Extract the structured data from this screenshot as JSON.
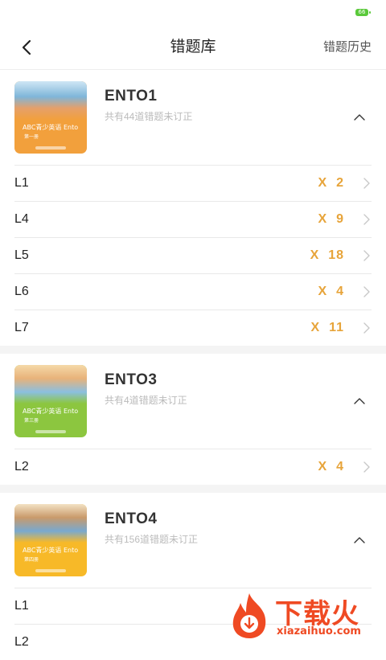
{
  "status_bar": {
    "battery": "66"
  },
  "header": {
    "title": "错题库",
    "right_action": "错题历史"
  },
  "books": [
    {
      "title": "ENTO1",
      "subtitle": "共有44道错题未订正",
      "cover": {
        "title": "ABC青少英语 Ento",
        "subtitle": "第一册"
      },
      "lessons": [
        {
          "label": "L1",
          "count": "X  2"
        },
        {
          "label": "L4",
          "count": "X  9"
        },
        {
          "label": "L5",
          "count": "X  18"
        },
        {
          "label": "L6",
          "count": "X  4"
        },
        {
          "label": "L7",
          "count": "X  11"
        }
      ]
    },
    {
      "title": "ENTO3",
      "subtitle": "共有4道错题未订正",
      "cover": {
        "title": "ABC青少英语 Ento",
        "subtitle": "第三册"
      },
      "lessons": [
        {
          "label": "L2",
          "count": "X  4"
        }
      ]
    },
    {
      "title": "ENTO4",
      "subtitle": "共有156道错题未订正",
      "cover": {
        "title": "ABC青少英语 Ento",
        "subtitle": "第四册"
      },
      "lessons": [
        {
          "label": "L1",
          "count": ""
        },
        {
          "label": "L2",
          "count": ""
        }
      ]
    }
  ],
  "watermark": {
    "text": "下载火",
    "url": "xiazaihuo.com"
  },
  "colors": {
    "accent": "#e7a43a",
    "cover1": "#f2a03c",
    "cover2": "#8cc63f",
    "cover3": "#f7b928",
    "watermark": "#ef4a23"
  }
}
